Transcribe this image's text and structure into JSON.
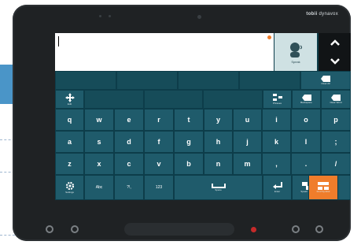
{
  "brand": {
    "strong": "tobii",
    "rest": " dynavox"
  },
  "speak_tile": {
    "label": "Speak"
  },
  "keyboard": {
    "row_tools": {
      "move_label": "Edit",
      "phrase_label": "Phrases",
      "backspace_label": "Backspace",
      "clear_label": "Clear Word",
      "clear_top_label": "Clear All"
    },
    "row_q": [
      "q",
      "w",
      "e",
      "r",
      "t",
      "y",
      "u",
      "i",
      "o",
      "p"
    ],
    "row_a": [
      "a",
      "s",
      "d",
      "f",
      "g",
      "h",
      "j",
      "k",
      "l",
      ";"
    ],
    "row_z": [
      "z",
      "x",
      "c",
      "v",
      "b",
      "n",
      "m",
      ",",
      ".",
      "/"
    ],
    "bottom": {
      "settings": "Settings",
      "abc": "Abc",
      "punct": "?!,",
      "numbers": "123",
      "space": "Space",
      "enter": "Enter",
      "tts": "Speak Talk",
      "check": "√",
      "home": "Find Symbol"
    }
  },
  "colors": {
    "key": "#1f5b6b",
    "screen_bg": "#0d3d4a",
    "accent": "#f07d2b"
  }
}
